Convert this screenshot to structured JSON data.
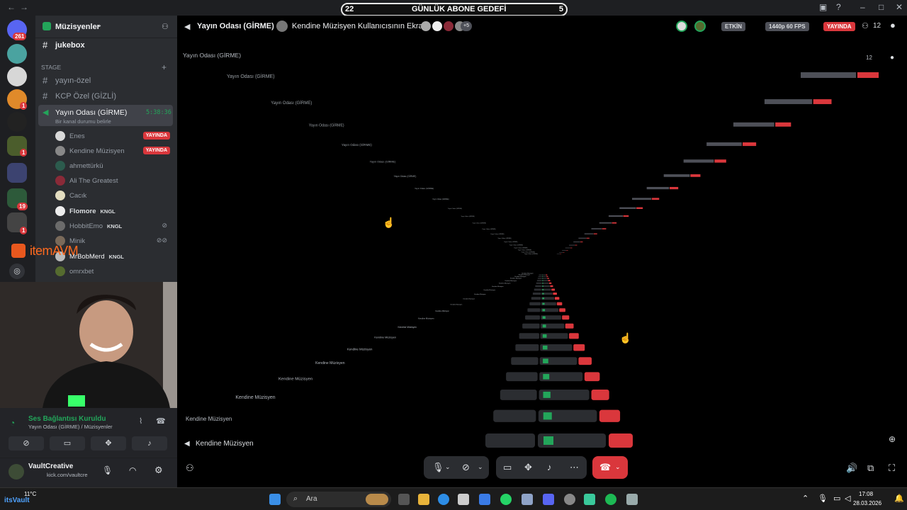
{
  "goal": {
    "left_count": "22",
    "title": "GÜNLÜK ABONE GEDEFİ",
    "right_count": "5"
  },
  "rail": {
    "home_badge": "261",
    "badges": [
      "1",
      "1",
      "19",
      "1"
    ]
  },
  "server": {
    "name": "Müzisyenler"
  },
  "channels": {
    "jukebox": "jukebox",
    "stage_header": "STAGE",
    "yayin_ozel": "yayın-özel",
    "kcp": "KCP Özel (GİZLİ)",
    "active": {
      "name": "Yayın Odası (GİRME)",
      "timer": "5:38:36",
      "status": "Bir kanal durumu belirle"
    }
  },
  "voice_users": [
    {
      "name": "Enes",
      "live": "YAYINDA"
    },
    {
      "name": "Kendine Müzisyen",
      "live": "YAYINDA"
    },
    {
      "name": "ahmettürkü"
    },
    {
      "name": "Ali The Greatest"
    },
    {
      "name": "Cacık"
    },
    {
      "name": "Flomore",
      "tag": "KNGL"
    },
    {
      "name": "HobbitEmo",
      "tag": "KNGL"
    },
    {
      "name": "Minik"
    },
    {
      "name": "MrBobMerd",
      "tag": "KNGL"
    },
    {
      "name": "omrxbet"
    }
  ],
  "overlay_logo": "itemAVM",
  "voice_panel": {
    "status": "Ses Bağlantısı Kuruldu",
    "channel": "Yayın Odası (GİRME) / Müzisyenler",
    "user": "VaultCreative",
    "user_sub": "kick.com/vaultcre"
  },
  "main": {
    "channel": "Yayın Odası (GİRME)",
    "screen_title": "Kendine Müzisyen Kullanıcısının Ekranı",
    "extra_viewers": "+5",
    "active_pill": "ETKİN",
    "quality": "1440p 60 FPS",
    "live": "YAYINDA",
    "viewers": "12",
    "stream_user": "Kendine Müzisyen",
    "recursive_channel": "Yayın Odası (GİRME)"
  },
  "taskbar": {
    "weather": "11°C",
    "search": "Ara",
    "time": "17:08",
    "date": "28.03.2026",
    "corner_tag": "itsVault"
  },
  "colors": {
    "live_red": "#da373c",
    "green": "#23a55a",
    "orange": "#e8813a",
    "discord_dark": "#2b2d31"
  }
}
